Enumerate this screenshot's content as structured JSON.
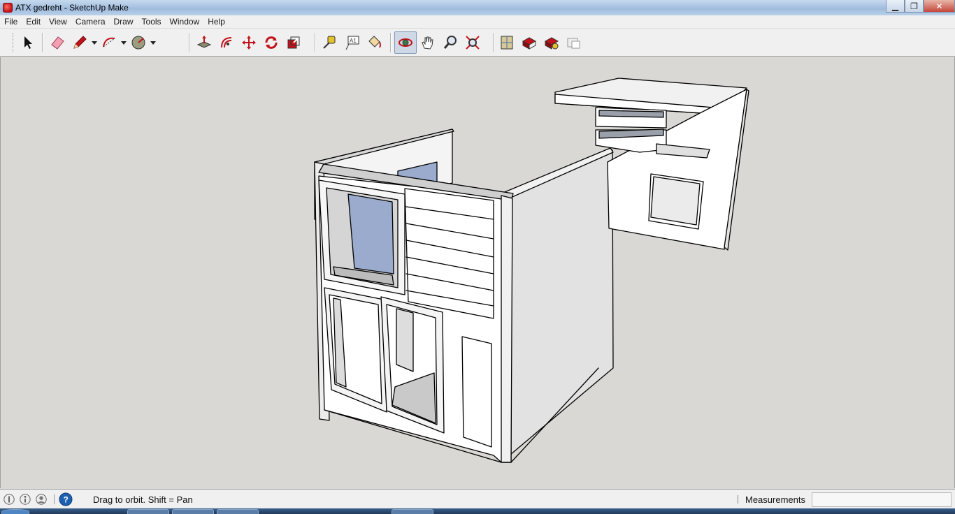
{
  "window": {
    "title": "ATX gedreht - SketchUp Make",
    "controls": {
      "minimize": "▁",
      "restore": "❐",
      "close": "✕"
    }
  },
  "menu": [
    "File",
    "Edit",
    "View",
    "Camera",
    "Draw",
    "Tools",
    "Window",
    "Help"
  ],
  "toolbar": {
    "tools": [
      {
        "name": "select-tool",
        "icon": "arrow-cursor-icon"
      },
      {
        "name": "eraser-tool",
        "icon": "eraser-icon"
      },
      {
        "name": "line-tool",
        "icon": "pencil-icon",
        "dropdown": true
      },
      {
        "name": "arc-tool",
        "icon": "arc-icon",
        "dropdown": true
      },
      {
        "name": "shapes-tool",
        "icon": "circle-icon",
        "dropdown": true
      },
      {
        "name": "push-pull-tool",
        "icon": "push-pull-icon"
      },
      {
        "name": "offset-tool",
        "icon": "offset-icon"
      },
      {
        "name": "move-tool",
        "icon": "move-icon"
      },
      {
        "name": "rotate-tool",
        "icon": "rotate-icon"
      },
      {
        "name": "scale-tool",
        "icon": "scale-icon"
      },
      {
        "name": "tape-measure-tool",
        "icon": "tape-measure-icon"
      },
      {
        "name": "text-tool",
        "icon": "text-label-icon",
        "label": "A1"
      },
      {
        "name": "paint-bucket-tool",
        "icon": "paint-bucket-icon"
      },
      {
        "name": "orbit-tool",
        "icon": "orbit-icon",
        "active": true
      },
      {
        "name": "pan-tool",
        "icon": "hand-icon"
      },
      {
        "name": "zoom-tool",
        "icon": "magnifier-icon"
      },
      {
        "name": "zoom-extents-tool",
        "icon": "zoom-extents-icon"
      },
      {
        "name": "3d-warehouse-button",
        "icon": "warehouse-map-icon"
      },
      {
        "name": "share-model-button",
        "icon": "share-model-icon"
      },
      {
        "name": "extension-warehouse-button",
        "icon": "extension-icon"
      },
      {
        "name": "send-to-layout-button",
        "icon": "layout-icon"
      }
    ]
  },
  "status": {
    "hint": "Drag to orbit.  Shift = Pan",
    "measurements_label": "Measurements",
    "measurements_value": ""
  },
  "colors": {
    "background": "#d9d8d4",
    "face": "#ffffff",
    "face_shaded": "#e4e4e4",
    "glass": "#9aabcd",
    "accent_red": "#c4121a"
  }
}
